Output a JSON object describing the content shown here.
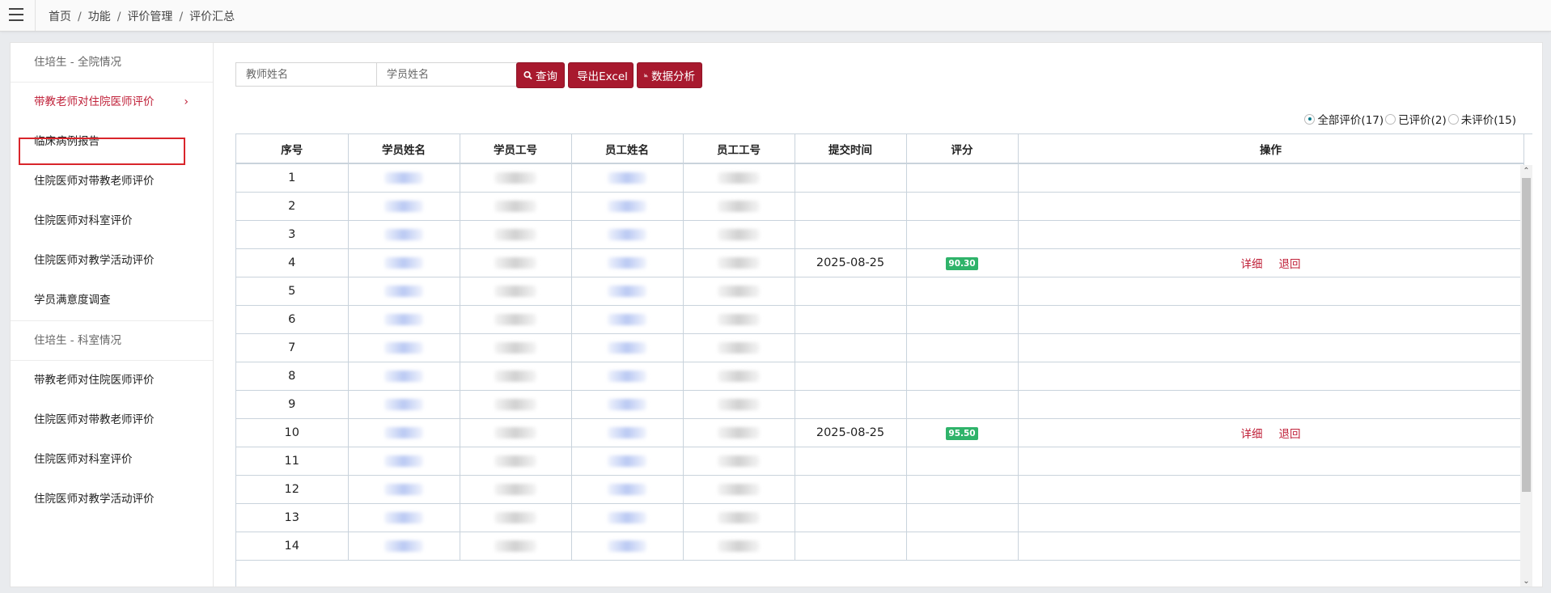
{
  "breadcrumb": [
    "首页",
    "功能",
    "评价管理",
    "评价汇总"
  ],
  "sidebar": {
    "group1": "住培生 - 全院情况",
    "group1_items": [
      {
        "label": "带教老师对住院医师评价",
        "active": true
      },
      {
        "label": "临床病例报告"
      },
      {
        "label": "住院医师对带教老师评价"
      },
      {
        "label": "住院医师对科室评价"
      },
      {
        "label": "住院医师对教学活动评价"
      },
      {
        "label": "学员满意度调查"
      }
    ],
    "group2": "住培生 - 科室情况",
    "group2_items": [
      {
        "label": "带教老师对住院医师评价"
      },
      {
        "label": "住院医师对带教老师评价"
      },
      {
        "label": "住院医师对科室评价"
      },
      {
        "label": "住院医师对教学活动评价"
      }
    ]
  },
  "search": {
    "teacher_placeholder": "教师姓名",
    "student_placeholder": "学员姓名",
    "query_label": "查询",
    "export_label": "导出Excel",
    "analysis_label": "数据分析"
  },
  "filters": {
    "all": "全部评价(17)",
    "done": "已评价(2)",
    "pending": "未评价(15)",
    "selected": "all"
  },
  "table": {
    "headers": [
      "序号",
      "学员姓名",
      "学员工号",
      "员工姓名",
      "员工工号",
      "提交时间",
      "评分",
      "操作"
    ],
    "rows": [
      {
        "no": "1"
      },
      {
        "no": "2"
      },
      {
        "no": "3"
      },
      {
        "no": "4",
        "time": "2025-08-25",
        "score": "90.30",
        "ops": [
          "详细",
          "退回"
        ]
      },
      {
        "no": "5"
      },
      {
        "no": "6"
      },
      {
        "no": "7"
      },
      {
        "no": "8"
      },
      {
        "no": "9"
      },
      {
        "no": "10",
        "time": "2025-08-25",
        "score": "95.50",
        "ops": [
          "详细",
          "退回"
        ]
      },
      {
        "no": "11"
      },
      {
        "no": "12"
      },
      {
        "no": "13"
      },
      {
        "no": "14"
      }
    ]
  },
  "colors": {
    "brand": "#a8192e",
    "active_text": "#c0223a",
    "badge": "#2fb36a"
  }
}
